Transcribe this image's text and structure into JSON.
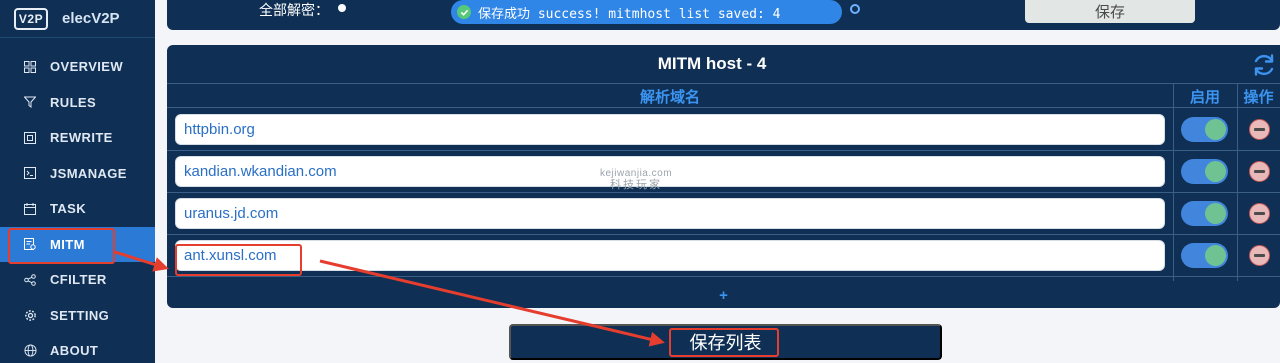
{
  "sidebar": {
    "logo": "V2P",
    "app_name": "elecV2P",
    "items": [
      {
        "label": "OVERVIEW",
        "icon": "grid-icon"
      },
      {
        "label": "RULES",
        "icon": "filter-icon"
      },
      {
        "label": "REWRITE",
        "icon": "rewrite-icon"
      },
      {
        "label": "JSMANAGE",
        "icon": "terminal-icon"
      },
      {
        "label": "TASK",
        "icon": "calendar-icon"
      },
      {
        "label": "MITM",
        "icon": "certificate-icon",
        "active": true
      },
      {
        "label": "CFILTER",
        "icon": "share-icon"
      },
      {
        "label": "SETTING",
        "icon": "gear-icon"
      },
      {
        "label": "ABOUT",
        "icon": "globe-icon"
      }
    ]
  },
  "topbar": {
    "decrypt_label": "全部解密：",
    "toast_text": "保存成功 success! mitmhost list saved: 4",
    "save_label": "保存"
  },
  "panel": {
    "title": "MITM host - 4",
    "col_domain": "解析域名",
    "col_enabled": "启用",
    "col_action": "操作",
    "add_label": "+"
  },
  "hosts": [
    {
      "host": "httpbin.org",
      "enabled": true
    },
    {
      "host": "kandian.wkandian.com",
      "enabled": true
    },
    {
      "host": "uranus.jd.com",
      "enabled": true
    },
    {
      "host": "ant.xunsl.com",
      "enabled": true
    }
  ],
  "save_list_label": "保存列表",
  "watermark": {
    "line1": "kejiwanjia.com",
    "line2": "科技玩家"
  },
  "colors": {
    "navy": "#0f3054",
    "accent": "#2a7ad6",
    "annotation": "#e53d2e"
  }
}
